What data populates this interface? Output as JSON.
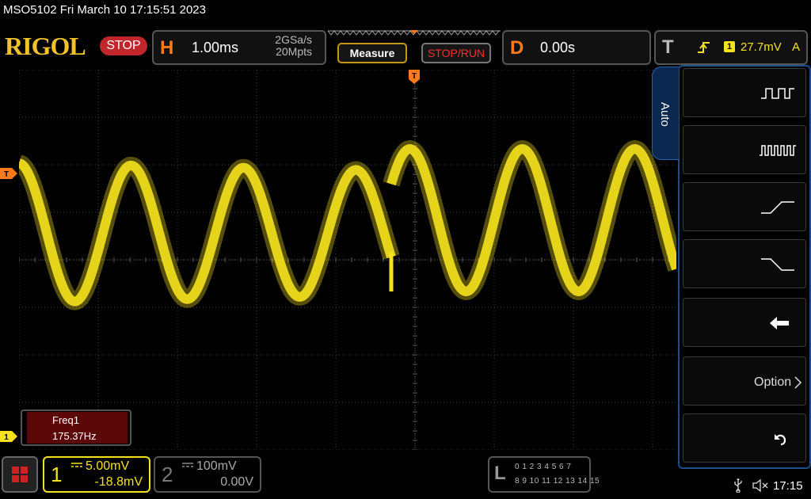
{
  "header": {
    "device_line": "MSO5102  Fri March 10 17:15:51 2023"
  },
  "toolbar": {
    "logo": "RIGOL",
    "run_state": "STOP",
    "horizontal": {
      "letter": "H",
      "scale": "1.00ms",
      "sample_rate": "2GSa/s",
      "memory_depth": "20Mpts"
    },
    "measure_label": "Measure",
    "stoprun_label": "STOP/RUN",
    "delay": {
      "letter": "D",
      "value": "0.00s"
    },
    "trigger": {
      "letter": "T",
      "source": "1",
      "level": "27.7mV",
      "mode": "A"
    }
  },
  "grid_markers": {
    "trigger_position": "T",
    "trigger_level": "T",
    "ch1_offset": "1"
  },
  "measurement": {
    "label": "Freq1",
    "value": "175.37Hz"
  },
  "menu": {
    "auto_tab": "Auto",
    "items": [
      {
        "icon": "multi-period-icon"
      },
      {
        "icon": "single-period-icon"
      },
      {
        "icon": "rising-edge-icon"
      },
      {
        "icon": "falling-edge-icon"
      },
      {
        "icon": "back-arrow-icon"
      },
      {
        "icon": "chevron-right-icon",
        "label": "Option"
      },
      {
        "icon": "undo-icon"
      }
    ]
  },
  "channels": {
    "ch1": {
      "number": "1",
      "scale": "5.00mV",
      "offset": "-18.8mV"
    },
    "ch2": {
      "number": "2",
      "scale": "100mV",
      "offset": "0.00V"
    }
  },
  "logic": {
    "letter": "L",
    "row1": "0 1 2 3   4 5 6 7",
    "row2": "8 9 10 11 12 13 14 15"
  },
  "status": {
    "time": "17:15"
  },
  "colors": {
    "ch1": "#f6e21c",
    "accent_orange": "#ff7a1a",
    "menu_border": "#1a4e8c",
    "stop_red": "#c0262a"
  }
}
